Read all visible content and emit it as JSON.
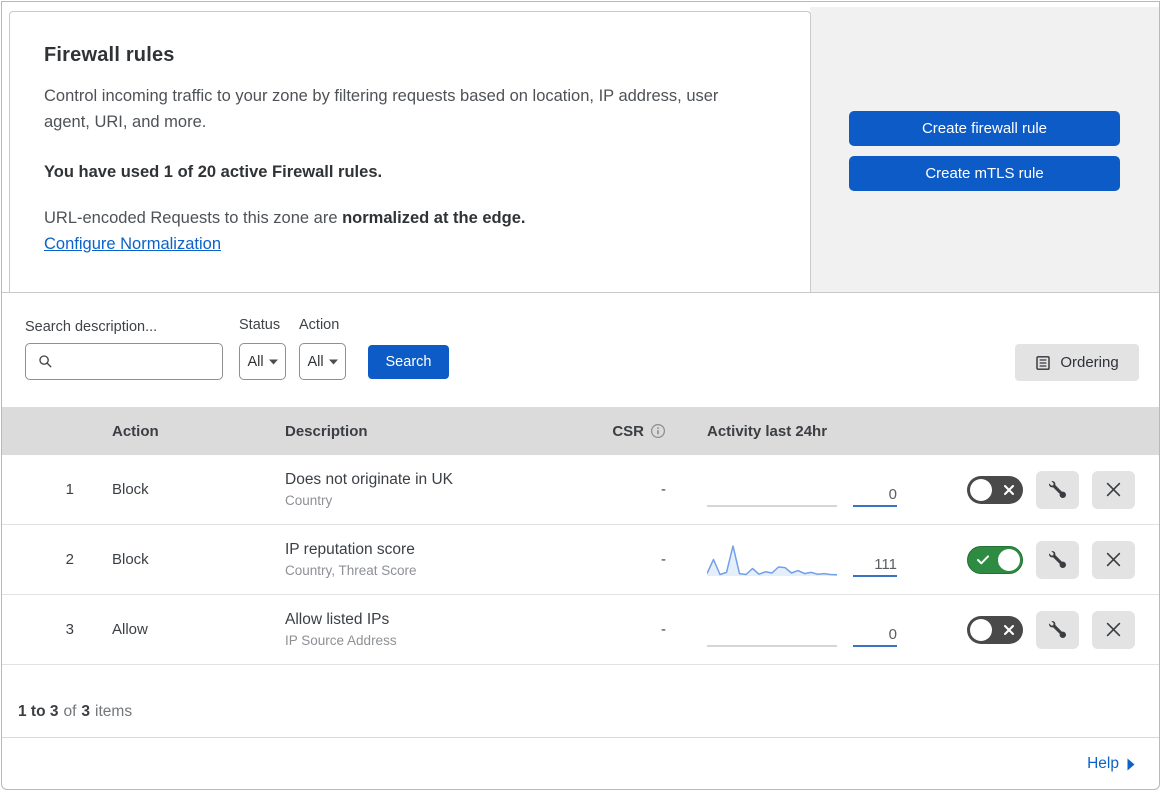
{
  "header": {
    "title": "Firewall rules",
    "description": "Control incoming traffic to your zone by filtering requests based on location, IP address, user agent, URI, and more.",
    "usage_notice": "You have used 1 of 20 active Firewall rules.",
    "normalization_prefix": "URL-encoded Requests to this zone are ",
    "normalization_bold": "normalized at the edge.",
    "normalization_link": "Configure Normalization",
    "create_firewall_button": "Create firewall rule",
    "create_mtls_button": "Create mTLS rule"
  },
  "filters": {
    "search_label": "Search description...",
    "status_label": "Status",
    "status_value": "All",
    "action_label": "Action",
    "action_value": "All",
    "search_button": "Search",
    "ordering_button": "Ordering"
  },
  "table": {
    "columns": {
      "action": "Action",
      "description": "Description",
      "csr": "CSR",
      "activity": "Activity last 24hr"
    },
    "rows": [
      {
        "priority": "1",
        "action": "Block",
        "description": "Does not originate in UK",
        "fields": "Country",
        "csr": "-",
        "activity_count": "0",
        "enabled": false,
        "sparkline": []
      },
      {
        "priority": "2",
        "action": "Block",
        "description": "IP reputation score",
        "fields": "Country, Threat Score",
        "csr": "-",
        "activity_count": "111",
        "enabled": true,
        "sparkline": [
          8,
          55,
          5,
          12,
          100,
          8,
          5,
          25,
          6,
          14,
          10,
          30,
          28,
          10,
          18,
          8,
          12,
          6,
          8,
          5,
          4
        ]
      },
      {
        "priority": "3",
        "action": "Allow",
        "description": "Allow listed IPs",
        "fields": "IP Source Address",
        "csr": "-",
        "activity_count": "0",
        "enabled": false,
        "sparkline": []
      }
    ]
  },
  "footer": {
    "range_bold": "1 to 3",
    "of_text": "of",
    "total_bold": "3",
    "items_text": "items",
    "help_label": "Help"
  },
  "colors": {
    "primary_blue": "#0d5bc6",
    "link_blue": "#0b62ca",
    "toggle_on_green": "#2d8c41",
    "toggle_off_gray": "#494949",
    "sparkline_blue": "#71a0e8",
    "sparkline_flat_gray": "#c9c9c9",
    "table_header_bg": "#dbdbdb",
    "panel_gray": "#f1f1f1"
  }
}
